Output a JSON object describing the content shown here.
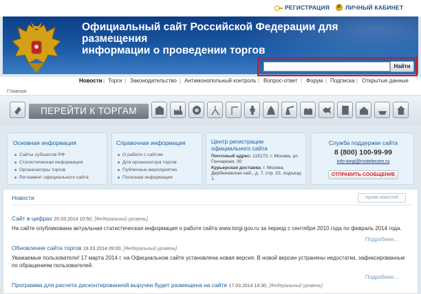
{
  "topbar": {
    "register": "РЕГИСТРАЦИЯ",
    "cabinet": "ЛИЧНЫЙ КАБИНЕТ"
  },
  "header": {
    "title_line1": "Официальный сайт Российской Федерации для размещения",
    "title_line2": "информации о проведении торгов"
  },
  "search": {
    "value": "",
    "button": "Найти"
  },
  "nav": [
    "Новости",
    "Торги",
    "Законодательство",
    "Антимонопольный контроль",
    "Вопрос-ответ",
    "Форум",
    "Подписка",
    "Открытые данные"
  ],
  "breadcrumb": "Главная",
  "goto_button": "ПЕРЕЙТИ К ТОРГАМ",
  "category_icons": [
    "building-icon",
    "factory-icon",
    "gear-icon",
    "survey-icon",
    "crane-icon",
    "worker-icon",
    "forest-icon",
    "oil-pump-icon",
    "water-icon",
    "fish-icon",
    "apartment-icon",
    "farm-icon",
    "boat-icon",
    "house-icon"
  ],
  "panels": {
    "main": {
      "title": "Основная информация",
      "items": [
        "Сайты субъектов РФ",
        "Статистическая информация",
        "Организаторы торгов",
        "Регламент официального сайта"
      ]
    },
    "ref": {
      "title": "Справочная информация",
      "items": [
        "О работе с сайтом",
        "Для организатора торгов",
        "Публичные мероприятия",
        "Полезная информация"
      ]
    },
    "center": {
      "title": "Центр регистрации официального сайта",
      "addr_label": "Почтовый адрес:",
      "addr": "115172, г. Москва, ул. Гончарная, 30",
      "courier_label": "Курьерская доставка:",
      "courier": "г. Москва, Дербеневская наб., д. 7, стр. 22, подъезд 1."
    },
    "support": {
      "title": "Служба поддержки сайта",
      "phone": "8 (800) 100-99-99",
      "email": "info-torgi@rostelecom.ru",
      "send": "ОТПРАВИТЬ СООБЩЕНИЕ"
    }
  },
  "news": {
    "heading": "Новости",
    "archive": "Архив новостей",
    "more": "Подробнее...",
    "items": [
      {
        "title": "Сайт в цифрах",
        "date": "20.03.2014 10:50,",
        "level": "[Федеральный уровень]",
        "body": "На сайте опубликована актуальная статистическая информация о работе сайта www.torgi.gov.ru за период с сентября 2010 года по февраль 2014 года."
      },
      {
        "title": "Обновление сайта торгов",
        "date": "18.03.2014 09:00,",
        "level": "[Федеральный уровень]",
        "body": "Уважаемые пользователи! 17 марта 2014 г. на Официальном сайте установлена новая версия. В новой версии устранены недостатки, зафиксированные по обращениям пользователей."
      },
      {
        "title": "Программа для расчета дисконтированной выручки будет размещена на сайте",
        "date": "17.03.2014 14:30,",
        "level": "[Федеральный уровень]",
        "body": ""
      }
    ]
  }
}
